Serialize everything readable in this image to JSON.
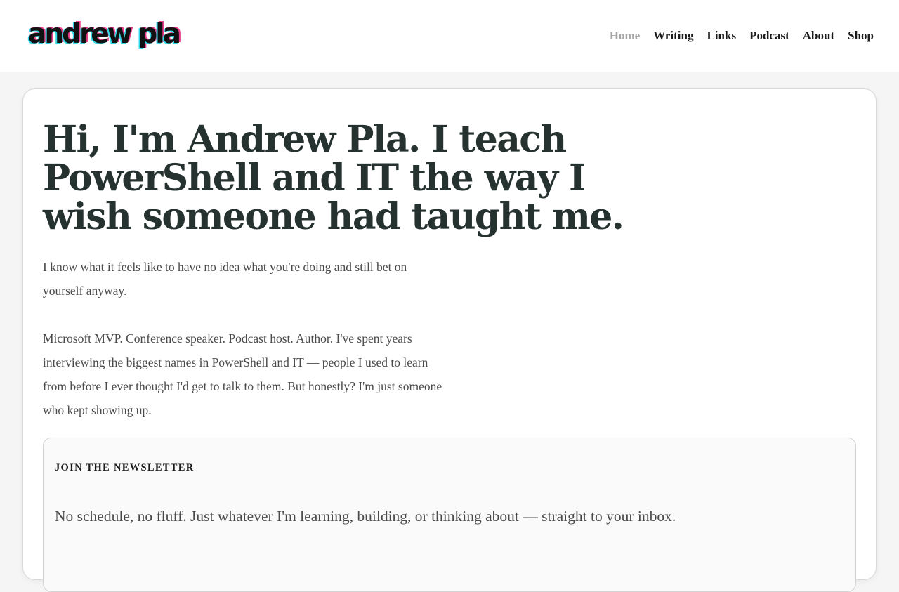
{
  "header": {
    "logo_text": "andrew pla",
    "nav": [
      {
        "label": "Home",
        "active": true
      },
      {
        "label": "Writing",
        "active": false
      },
      {
        "label": "Links",
        "active": false
      },
      {
        "label": "Podcast",
        "active": false
      },
      {
        "label": "About",
        "active": false
      },
      {
        "label": "Shop",
        "active": false
      }
    ]
  },
  "hero": {
    "title": "Hi, I'm Andrew Pla. I teach PowerShell and IT the way I wish someone had taught me.",
    "intro": "I know what it feels like to have no idea what you're doing and still bet on yourself anyway.",
    "bio": "Microsoft MVP. Conference speaker. Podcast host. Author. I've spent years interviewing the biggest names in PowerShell and IT — people I used to learn from before I ever thought I'd get to talk to them. But honestly? I'm just someone who kept showing up."
  },
  "newsletter": {
    "heading": "JOIN THE NEWSLETTER",
    "description": "No schedule, no fluff. Just whatever I'm learning, building, or thinking about — straight to your inbox."
  },
  "colors": {
    "page_background": "#f5f5f5",
    "heading": "#263230",
    "body_text": "#4a4a4a",
    "nav_active": "#a6a6a6",
    "logo_accent_cyan": "#35d6e6",
    "logo_accent_pink": "#e83e8c"
  }
}
